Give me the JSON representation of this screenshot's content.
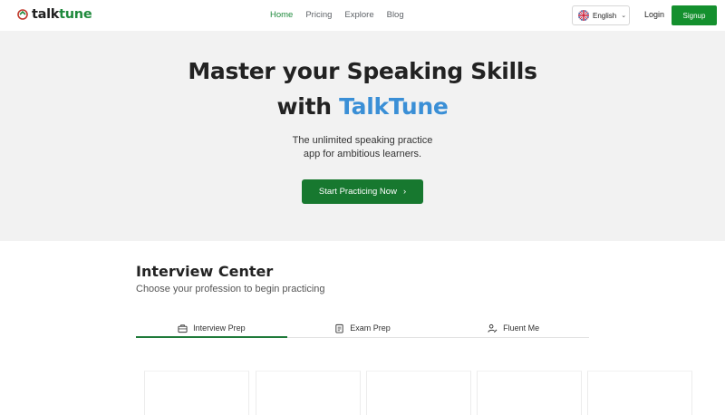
{
  "header": {
    "logo": {
      "part1": "talk",
      "part2": "tune"
    },
    "nav": [
      {
        "label": "Home",
        "active": true
      },
      {
        "label": "Pricing",
        "active": false
      },
      {
        "label": "Explore",
        "active": false
      },
      {
        "label": "Blog",
        "active": false
      }
    ],
    "language": {
      "label": "English",
      "flag": "uk-flag-icon"
    },
    "login_label": "Login",
    "signup_label": "Signup"
  },
  "hero": {
    "title_line1": "Master your Speaking Skills",
    "title_line2_prefix": "with ",
    "title_line2_brand": "TalkTune",
    "subtitle_line1": "The unlimited speaking practice",
    "subtitle_line2": "app for ambitious learners.",
    "cta_label": "Start Practicing Now",
    "cta_icon": "chevron-right-icon"
  },
  "interview_center": {
    "title": "Interview Center",
    "subtitle": "Choose your profession to begin practicing",
    "tabs": [
      {
        "label": "Interview Prep",
        "icon": "briefcase-icon",
        "active": true
      },
      {
        "label": "Exam Prep",
        "icon": "clipboard-icon",
        "active": false
      },
      {
        "label": "Fluent Me",
        "icon": "person-edit-icon",
        "active": false
      }
    ]
  },
  "colors": {
    "brand_green": "#1f8a3c",
    "cta_green": "#17782f",
    "brand_blue": "#3a8fd6",
    "hero_bg": "#f2f2f2"
  }
}
